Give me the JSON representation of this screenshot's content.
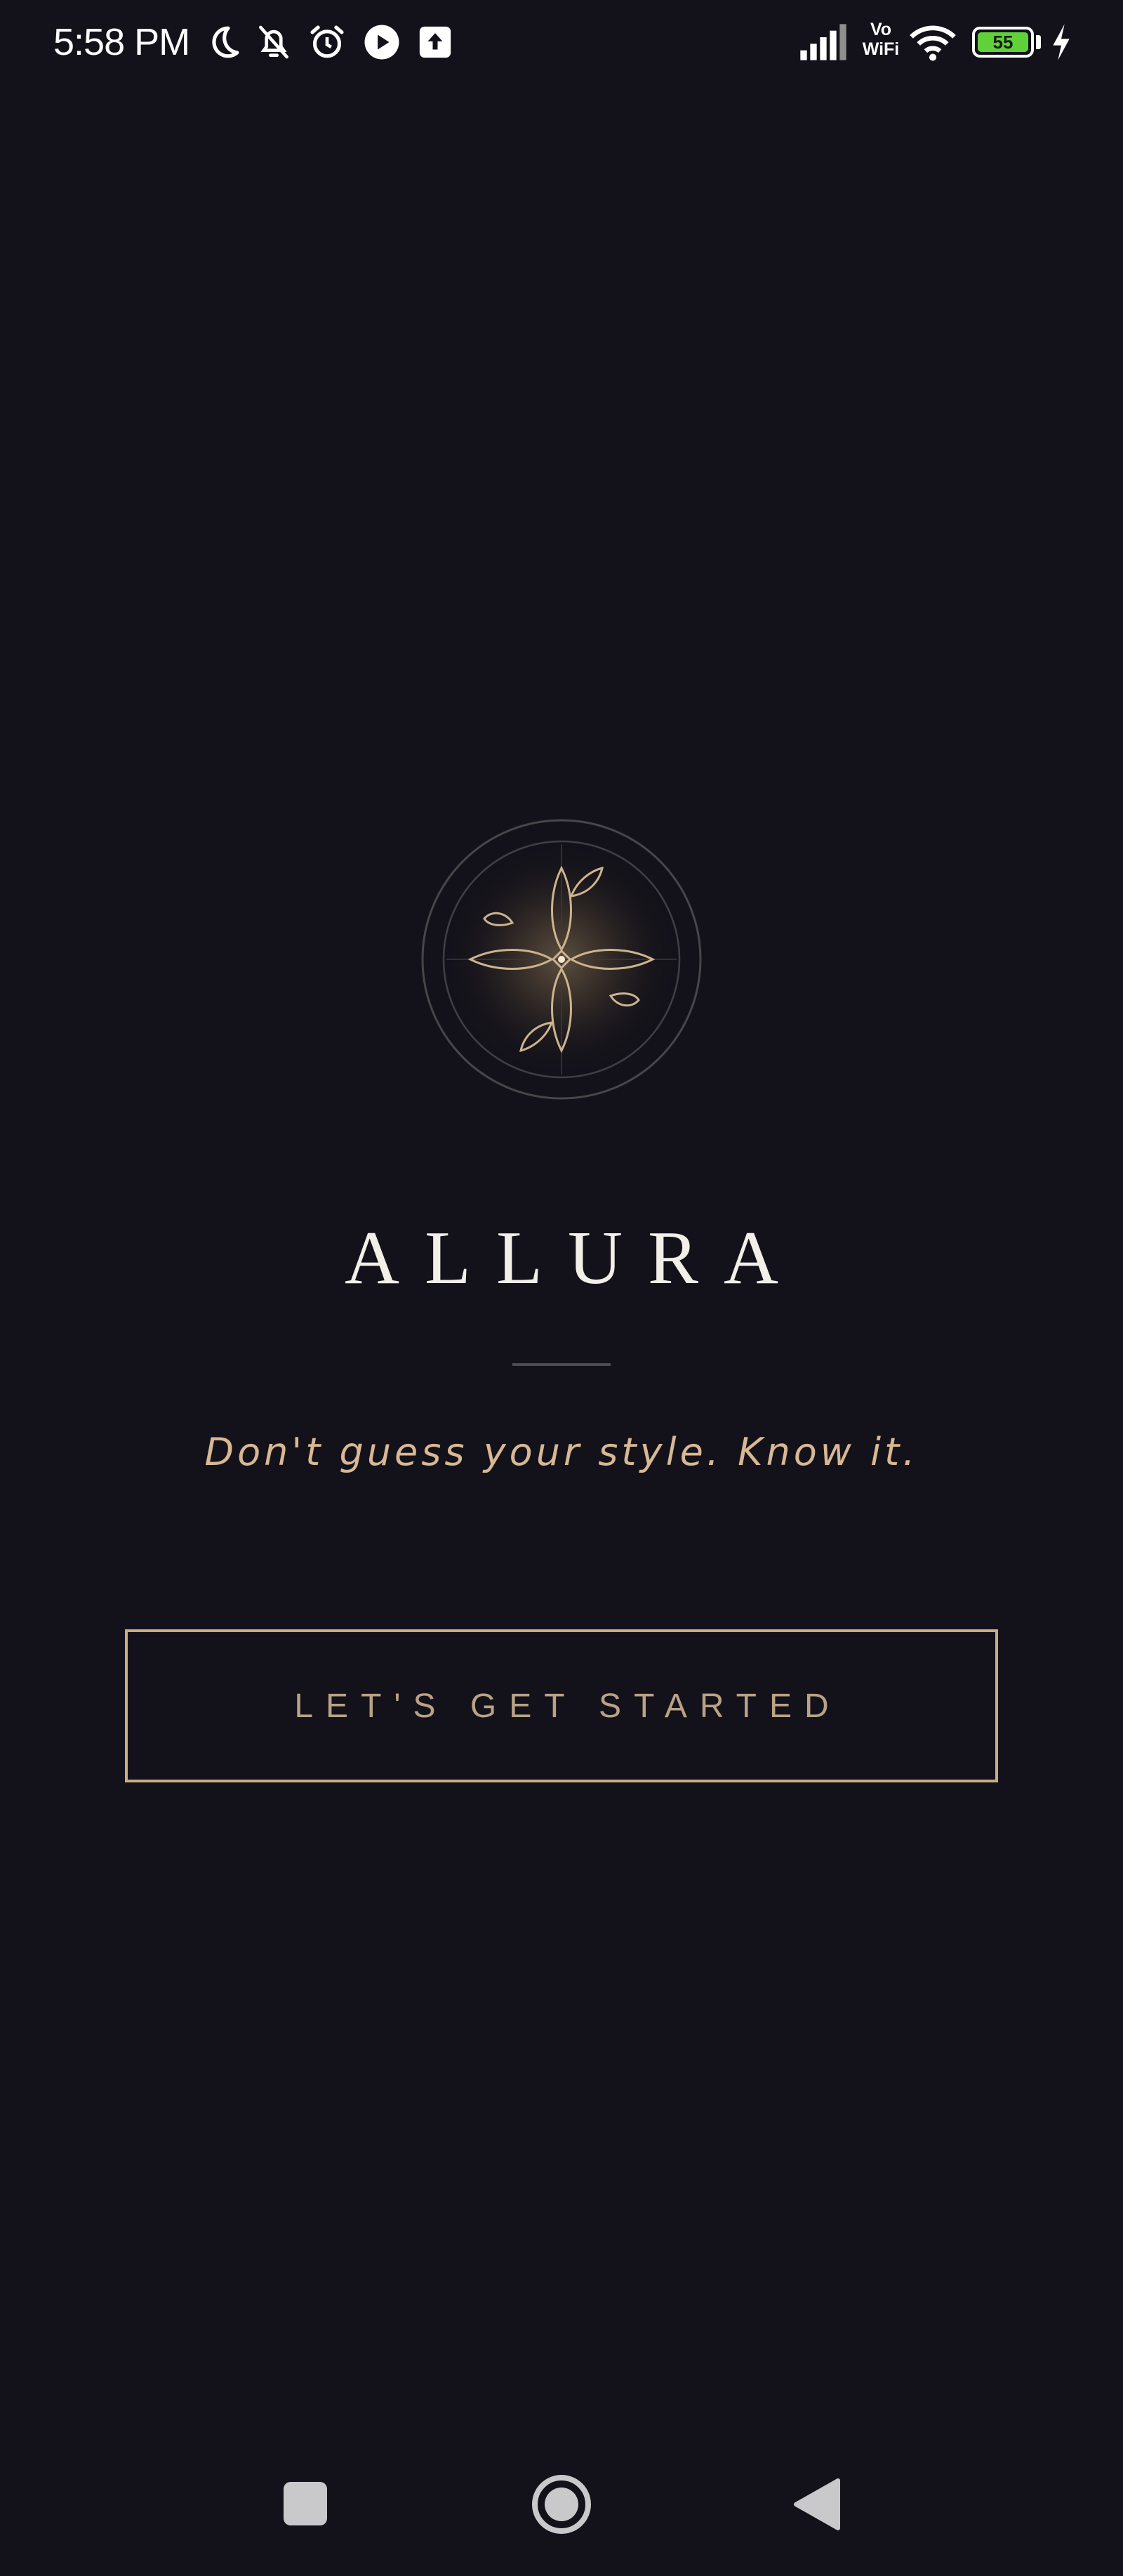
{
  "status_bar": {
    "time": "5:58 PM",
    "icons": [
      "moon-icon",
      "bell-off-icon",
      "alarm-icon",
      "play-icon",
      "upload-icon",
      "signal-icon",
      "vowifi-icon",
      "wifi-icon",
      "battery-icon",
      "charging-icon"
    ],
    "vowifi_top": "Vo",
    "vowifi_bottom": "WiFi",
    "battery_level": "55",
    "battery_color": "#5fd23a"
  },
  "splash": {
    "logo_icon": "floral-emblem-icon",
    "title": "ALLURA",
    "tagline": "Don't guess your style. Know it.",
    "cta_label": "LET'S GET STARTED"
  },
  "nav_bar": {
    "buttons": [
      "recents-button",
      "home-button",
      "back-button"
    ]
  },
  "colors": {
    "background": "#13121a",
    "accent_gold": "#c8ad86",
    "tagline": "#d8b894",
    "title": "#f2efe9"
  }
}
